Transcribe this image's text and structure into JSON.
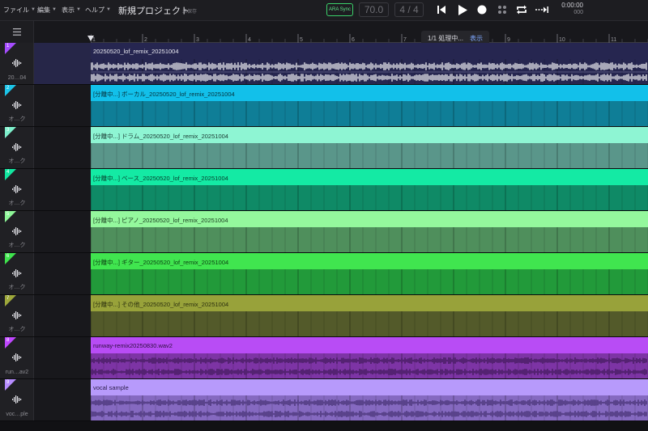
{
  "menu": {
    "file": "ファイル",
    "edit": "編集",
    "view": "表示",
    "help": "ヘルプ"
  },
  "project": {
    "title": "新規プロジェクト",
    "status": "未保存"
  },
  "transport": {
    "ara_sync": "ARA Sync",
    "tempo": "70.0",
    "time_signature": "4 / 4",
    "time_main": "0:00:00",
    "time_sub": "000"
  },
  "ruler": {
    "bars": [
      "1",
      "2",
      "3",
      "4",
      "5",
      "6",
      "7",
      "8",
      "9",
      "10",
      "11"
    ]
  },
  "notification": {
    "text": "1/1 処理中...",
    "action": "表示"
  },
  "tracks": [
    {
      "number": "1",
      "name": "20…04",
      "clip_title": "20250520_lof_remix_20251004",
      "colors": {
        "flag": "#a64dff",
        "header": "#1a1a2e",
        "body": "#262650",
        "text": "#e8e8f0",
        "wave": "#ffffff"
      }
    },
    {
      "number": "2",
      "name": "オ…ク",
      "clip_title": "[分離中...] ボーカル_20250520_lof_remix_20251004",
      "colors": {
        "flag": "#1cc4e8",
        "header": "#12c0ea",
        "body": "#0f7e97",
        "text": "#06303a"
      }
    },
    {
      "number": "3",
      "name": "オ…ク",
      "clip_title": "[分離中...] ドラム_20250520_lof_remix_20251004",
      "colors": {
        "flag": "#7ef0cc",
        "header": "#8ef5d3",
        "body": "#5a968a",
        "text": "#1a3a33"
      }
    },
    {
      "number": "4",
      "name": "オ…ク",
      "clip_title": "[分離中...] ベース_20250520_lof_remix_20251004",
      "colors": {
        "flag": "#12e6a0",
        "header": "#14eaa4",
        "body": "#0f8a66",
        "text": "#08402f"
      }
    },
    {
      "number": "5",
      "name": "オ…ク",
      "clip_title": "[分離中...] ピアノ_20250520_lof_remix_20251004",
      "colors": {
        "flag": "#8df597",
        "header": "#94f89d",
        "body": "#4f8f5c",
        "text": "#1c4022"
      }
    },
    {
      "number": "6",
      "name": "オ…ク",
      "clip_title": "[分離中...] ギター_20250520_lof_remix_20251004",
      "colors": {
        "flag": "#3fe34d",
        "header": "#40e54f",
        "body": "#229a3a",
        "text": "#0b3d12"
      }
    },
    {
      "number": "7",
      "name": "オ…ク",
      "clip_title": "[分離中...] その他_20250520_lof_remix_20251004",
      "colors": {
        "flag": "#9ea83b",
        "header": "#98a23a",
        "body": "#535a2a",
        "text": "#2c300f"
      }
    },
    {
      "number": "8",
      "name": "run…av2",
      "clip_title": "runway-remix20250830.wav2",
      "colors": {
        "flag": "#bf47ff",
        "header": "#b84cf5",
        "body": "#7d34a5",
        "text": "#2e0f40",
        "wave": "#3a1650"
      }
    },
    {
      "number": "9",
      "name": "voc…ple",
      "clip_title": "vocal sample",
      "colors": {
        "flag": "#b68cff",
        "header": "#b79afb",
        "body": "#8569c0",
        "text": "#2b1d48",
        "wave": "#3d2a68"
      }
    }
  ],
  "icons": {
    "hamburger": "menu-icon",
    "skip_back": "skip-back-icon",
    "play": "play-icon",
    "record": "record-icon",
    "grid": "grid-icon",
    "loop": "loop-icon",
    "forward": "follow-icon",
    "track_type": "waveform-icon"
  }
}
